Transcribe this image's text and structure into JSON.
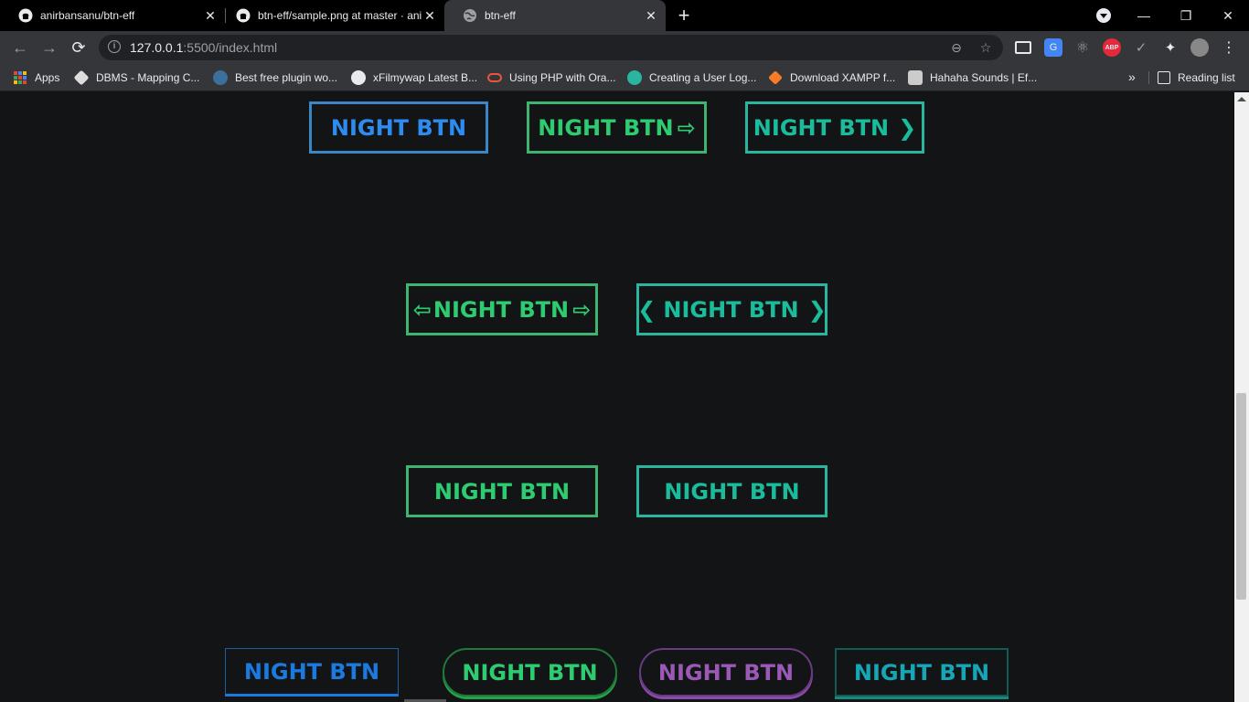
{
  "browser": {
    "tabs": [
      {
        "title": "anirbansanu/btn-eff",
        "close": "✕"
      },
      {
        "title": "btn-eff/sample.png at master · anirbansanu/btn-eff",
        "close": "✕"
      },
      {
        "title": "btn-eff",
        "close": "✕"
      }
    ],
    "new_tab": "+",
    "window_controls": {
      "minimize": "—",
      "restore": "❐",
      "close": "✕"
    },
    "nav": {
      "back": "←",
      "forward": "→",
      "reload": "⟳"
    },
    "address": {
      "host": "127.0.0.1",
      "path": ":5500/index.html"
    },
    "omnibox_icons": {
      "zoom": "⊖",
      "bookmark": "☆"
    },
    "extensions": [
      "",
      "G",
      "⚛",
      "ABP",
      "✓",
      "✦",
      "",
      "⋮"
    ],
    "bookmarks": [
      {
        "label": "Apps"
      },
      {
        "label": "DBMS - Mapping C..."
      },
      {
        "label": "Best free plugin wo..."
      },
      {
        "label": "xFilmywap Latest B..."
      },
      {
        "label": "Using PHP with Ora..."
      },
      {
        "label": "Creating a User Log..."
      },
      {
        "label": "Download XAMPP f..."
      },
      {
        "label": "Hahaha Sounds | Ef..."
      }
    ],
    "bookmarks_more": "»",
    "reading_list": "Reading list"
  },
  "colors": {
    "blue": "#2e8cf0",
    "green": "#2ecc71",
    "teal": "#1abc9c",
    "purple": "#9b59b6",
    "cyan": "#16a6b6",
    "background": "#131416"
  },
  "buttons": [
    {
      "label": "NIGHT BTN",
      "left": "",
      "right": ""
    },
    {
      "label": "NIGHT BTN",
      "left": "",
      "right": "⇨"
    },
    {
      "label": "NIGHT BTN",
      "left": "",
      "right": "❯"
    },
    {
      "label": "NIGHT BTN",
      "left": "⇦",
      "right": "⇨"
    },
    {
      "label": "NIGHT BTN",
      "left": "❮",
      "right": "❯"
    },
    {
      "label": "NIGHT BTN",
      "left": "",
      "right": ""
    },
    {
      "label": "NIGHT BTN",
      "left": "",
      "right": ""
    },
    {
      "label": "NIGHT BTN",
      "left": "",
      "right": ""
    },
    {
      "label": "NIGHT BTN",
      "left": "",
      "right": ""
    },
    {
      "label": "NIGHT BTN",
      "left": "",
      "right": ""
    },
    {
      "label": "NIGHT BTN",
      "left": "",
      "right": ""
    }
  ]
}
